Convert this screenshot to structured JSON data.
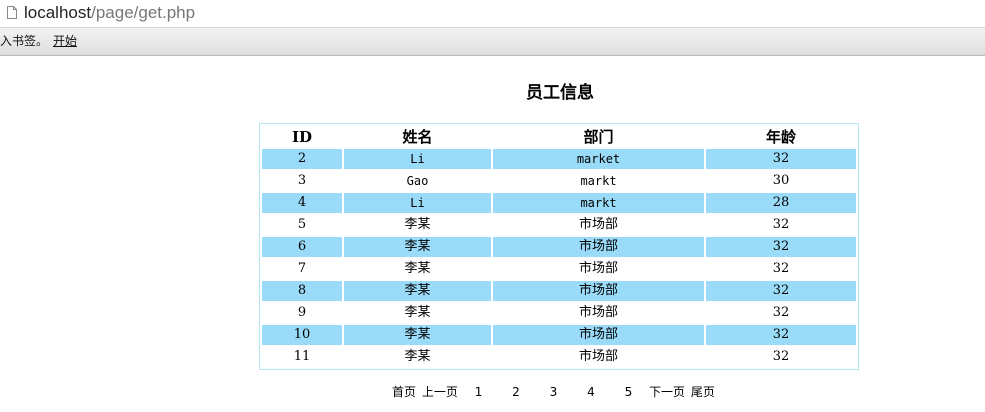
{
  "browser": {
    "url_host": "localhost",
    "url_path": "/page/get.php",
    "bookmarks_prefix": "入书签。",
    "bookmark_start": "开始"
  },
  "page": {
    "title": "员工信息"
  },
  "table": {
    "headers": [
      "ID",
      "姓名",
      "部门",
      "年龄"
    ],
    "rows": [
      {
        "id": "2",
        "name": "Li",
        "dept": "market",
        "age": "32"
      },
      {
        "id": "3",
        "name": "Gao",
        "dept": "markt",
        "age": "30"
      },
      {
        "id": "4",
        "name": "Li",
        "dept": "markt",
        "age": "28"
      },
      {
        "id": "5",
        "name": "李某",
        "dept": "市场部",
        "age": "32"
      },
      {
        "id": "6",
        "name": "李某",
        "dept": "市场部",
        "age": "32"
      },
      {
        "id": "7",
        "name": "李某",
        "dept": "市场部",
        "age": "32"
      },
      {
        "id": "8",
        "name": "李某",
        "dept": "市场部",
        "age": "32"
      },
      {
        "id": "9",
        "name": "李某",
        "dept": "市场部",
        "age": "32"
      },
      {
        "id": "10",
        "name": "李某",
        "dept": "市场部",
        "age": "32"
      },
      {
        "id": "11",
        "name": "李某",
        "dept": "市场部",
        "age": "32"
      }
    ],
    "alt_row_color": "#99dbf9",
    "border_color": "#b6e6ee"
  },
  "pager": {
    "first": "首页",
    "prev": "上一页",
    "pages": [
      "1",
      "2",
      "3",
      "4",
      "5"
    ],
    "next": "下一页",
    "last": "尾页"
  }
}
